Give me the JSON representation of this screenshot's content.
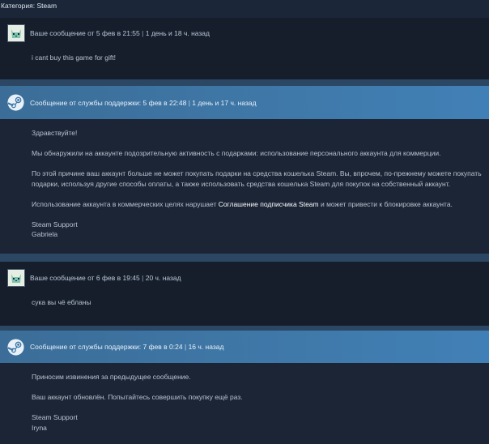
{
  "category": "Категория: Steam",
  "messages": [
    {
      "header_main": "Ваше сообщение от 5 фев в 21:55",
      "separator": "|",
      "header_ago": "1 день и 18 ч. назад",
      "body": "i cant buy this game for gift!"
    },
    {
      "header_main": "Сообщение от службы поддержки: 5 фев в 22:48",
      "separator": "|",
      "header_ago": "1 день и 17 ч. назад",
      "greeting": "Здравствуйте!",
      "p1": "Мы обнаружили на аккаунте подозрительную активность с подарками: использование персонального аккаунта для коммерции.",
      "p2_line1": "По этой причине ваш аккаунт больше не может покупать подарки на средства кошелька Steam. Вы, впрочем, по-прежнему можете покупать",
      "p2_line2": "подарки, используя другие способы оплаты, а также использовать средства кошелька Steam для покупок на собственный аккаунт.",
      "p3_before": "Использование аккаунта в коммерческих целях нарушает ",
      "p3_link": "Соглашение подписчика Steam",
      "p3_after": " и может привести к блокировке аккаунта.",
      "sign1": "Steam Support",
      "sign2": "Gabriela"
    },
    {
      "header_main": "Ваше сообщение от 6 фев в 19:45",
      "separator": "|",
      "header_ago": "20 ч. назад",
      "body": "сука вы чё ебланы"
    },
    {
      "header_main": "Сообщение от службы поддержки: 7 фев в 0:24",
      "separator": "|",
      "header_ago": "16 ч. назад",
      "p1": "Приносим извинения за предыдущее сообщение.",
      "p2": "Ваш аккаунт обновлён. Попытайтесь совершить покупку ещё раз.",
      "sign1": "Steam Support",
      "sign2": "Iryna"
    }
  ]
}
